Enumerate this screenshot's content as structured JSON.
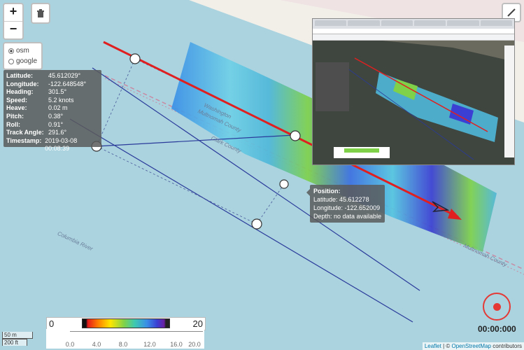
{
  "zoom": {
    "in_label": "+",
    "out_label": "−"
  },
  "layers": {
    "options": [
      {
        "label": "osm",
        "selected": true
      },
      {
        "label": "google",
        "selected": false
      }
    ]
  },
  "nav_tooltip": {
    "rows": [
      {
        "label": "Latitude:",
        "value": "45.612029°"
      },
      {
        "label": "Longitude:",
        "value": "-122.648548°"
      },
      {
        "label": "Heading:",
        "value": "301.5°"
      },
      {
        "label": "Speed:",
        "value": "5.2 knots"
      },
      {
        "label": "Heave:",
        "value": "0.02 m"
      },
      {
        "label": "Pitch:",
        "value": "0.38°"
      },
      {
        "label": "Roll:",
        "value": "0.91°"
      },
      {
        "label": "Track Angle:",
        "value": "291.6°"
      },
      {
        "label": "Timestamp:",
        "value": "2019-03-08 00:08:39"
      }
    ]
  },
  "position_tooltip": {
    "title": "Position:",
    "latitude": "Latitude: 45.612278",
    "longitude": "Longitude: -122.652009",
    "depth": "Depth: no data available"
  },
  "map_labels": {
    "county_1": "Multnomah County",
    "county_2": "Washington",
    "county_3": "Clark County",
    "river": "Columbia River",
    "county_4": "Multnomah County"
  },
  "color_legend": {
    "min": "0",
    "max": "20",
    "ticks": [
      "0.0",
      "4.0",
      "8.0",
      "12.0",
      "16.0",
      "20.0"
    ]
  },
  "scale": {
    "metric": "50 m",
    "imperial": "200 ft"
  },
  "recording": {
    "timer": "00:00:000"
  },
  "attribution": {
    "leaflet": "Leaflet",
    "sep": " | © ",
    "osm": "OpenStreetMap",
    "rest": " contributors"
  },
  "colors": {
    "water": "#aad3df",
    "track_red": "#e02020",
    "line_blue": "#2a3a9a"
  }
}
